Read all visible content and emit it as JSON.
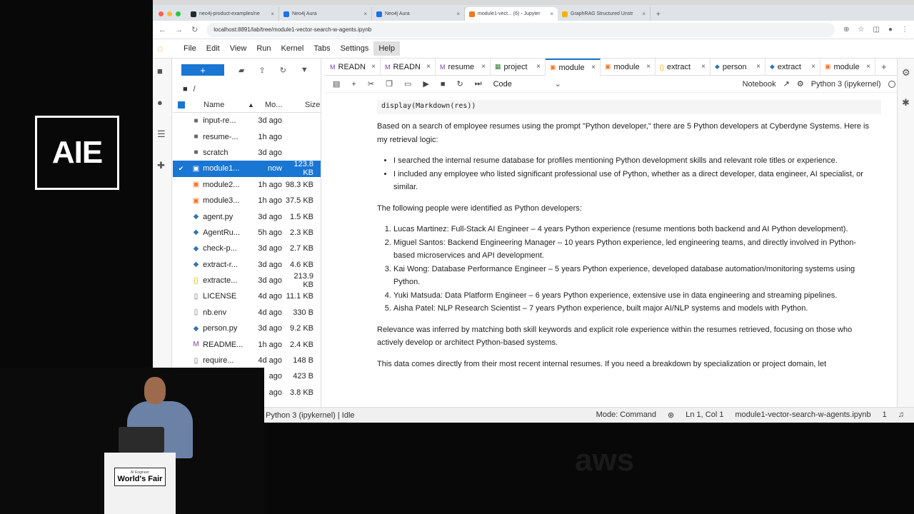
{
  "logo": {
    "text": "AIE"
  },
  "browser": {
    "tabs": [
      {
        "label": "neo4j-product-examples/ne",
        "color": "#24292f"
      },
      {
        "label": "Neo4j Aura",
        "color": "#1a73e8"
      },
      {
        "label": "Neo4j Aura",
        "color": "#1a73e8"
      },
      {
        "label": "module1-vect... (6) - Jupyter",
        "color": "#f37726"
      },
      {
        "label": "GraphRAG Structured Unstr",
        "color": "#f2b600"
      }
    ],
    "url": "localhost:8891/lab/tree/module1-vector-search-w-agents.ipynb"
  },
  "menu": [
    "File",
    "Edit",
    "View",
    "Run",
    "Kernel",
    "Tabs",
    "Settings",
    "Help"
  ],
  "filebrowser": {
    "new_label": "+",
    "breadcrumb": "/",
    "headers": {
      "name": "Name",
      "modified": "Mo...",
      "size": "Size"
    },
    "files": [
      {
        "icon": "folder-icon",
        "glyph": "■",
        "name": "input-re...",
        "modified": "3d ago",
        "size": ""
      },
      {
        "icon": "folder-icon",
        "glyph": "■",
        "name": "resume-...",
        "modified": "1h ago",
        "size": ""
      },
      {
        "icon": "folder-icon",
        "glyph": "■",
        "name": "scratch",
        "modified": "3d ago",
        "size": ""
      },
      {
        "icon": "notebook-icon",
        "glyph": "▣",
        "name": "module1...",
        "modified": "now",
        "size": "123.8 KB",
        "selected": true
      },
      {
        "icon": "notebook-icon",
        "glyph": "▣",
        "name": "module2...",
        "modified": "1h ago",
        "size": "98.3 KB"
      },
      {
        "icon": "notebook-icon",
        "glyph": "▣",
        "name": "module3...",
        "modified": "1h ago",
        "size": "37.5 KB"
      },
      {
        "icon": "python-icon",
        "glyph": "◆",
        "name": "agent.py",
        "modified": "3d ago",
        "size": "1.5 KB"
      },
      {
        "icon": "python-icon",
        "glyph": "◆",
        "name": "AgentRu...",
        "modified": "5h ago",
        "size": "2.3 KB"
      },
      {
        "icon": "python-icon",
        "glyph": "◆",
        "name": "check-p...",
        "modified": "3d ago",
        "size": "2.7 KB"
      },
      {
        "icon": "python-icon",
        "glyph": "◆",
        "name": "extract-r...",
        "modified": "3d ago",
        "size": "4.6 KB"
      },
      {
        "icon": "json-icon",
        "glyph": "{}",
        "name": "extracte...",
        "modified": "3d ago",
        "size": "213.9 KB"
      },
      {
        "icon": "file-icon",
        "glyph": "▯",
        "name": "LICENSE",
        "modified": "4d ago",
        "size": "11.1 KB"
      },
      {
        "icon": "file-icon",
        "glyph": "▯",
        "name": "nb.env",
        "modified": "4d ago",
        "size": "330 B"
      },
      {
        "icon": "python-icon",
        "glyph": "◆",
        "name": "person.py",
        "modified": "3d ago",
        "size": "9.2 KB"
      },
      {
        "icon": "markdown-icon",
        "glyph": "M",
        "name": "README...",
        "modified": "1h ago",
        "size": "2.4 KB"
      },
      {
        "icon": "file-icon",
        "glyph": "▯",
        "name": "require...",
        "modified": "4d ago",
        "size": "148 B"
      },
      {
        "icon": "file-icon",
        "glyph": "▯",
        "name": "",
        "modified": "ago",
        "size": "423 B"
      },
      {
        "icon": "file-icon",
        "glyph": "▯",
        "name": "",
        "modified": "ago",
        "size": "3.8 KB"
      }
    ]
  },
  "doc_tabs": [
    {
      "label": "READN",
      "icon": "markdown-icon",
      "glyph": "M"
    },
    {
      "label": "READN",
      "icon": "markdown-icon",
      "glyph": "M"
    },
    {
      "label": "resume",
      "icon": "markdown-icon",
      "glyph": "M"
    },
    {
      "label": "project",
      "icon": "table-icon",
      "glyph": "▦"
    },
    {
      "label": "module",
      "icon": "notebook-icon",
      "glyph": "▣",
      "active": true
    },
    {
      "label": "module",
      "icon": "notebook-icon",
      "glyph": "▣"
    },
    {
      "label": "extract",
      "icon": "json-icon",
      "glyph": "{}"
    },
    {
      "label": "person",
      "icon": "python-icon",
      "glyph": "◆"
    },
    {
      "label": "extract",
      "icon": "python-icon",
      "glyph": "◆"
    },
    {
      "label": "module",
      "icon": "notebook-icon",
      "glyph": "▣"
    }
  ],
  "nb_toolbar": {
    "cell_type": "Code",
    "notebook_label": "Notebook",
    "kernel": "Python 3 (ipykernel)"
  },
  "cell": {
    "code": "display(Markdown(res))",
    "intro": "Based on a search of employee resumes using the prompt \"Python developer,\" there are 5 Python developers at Cyberdyne Systems. Here is my retrieval logic:",
    "logic": [
      "I searched the internal resume database for profiles mentioning Python development skills and relevant role titles or experience.",
      "I included any employee who listed significant professional use of Python, whether as a direct developer, data engineer, AI specialist, or similar."
    ],
    "identified": "The following people were identified as Python developers:",
    "people": [
      "Lucas Martinez: Full-Stack AI Engineer – 4 years Python experience (resume mentions both backend and AI Python development).",
      "Miguel Santos: Backend Engineering Manager – 10 years Python experience, led engineering teams, and directly involved in Python-based microservices and API development.",
      "Kai Wong: Database Performance Engineer – 5 years Python experience, developed database automation/monitoring systems using Python.",
      "Yuki Matsuda: Data Platform Engineer – 6 years Python experience, extensive use in data engineering and streaming pipelines.",
      "Aisha Patel: NLP Research Scientist – 7 years Python experience, built major AI/NLP systems and models with Python."
    ],
    "relevance": "Relevance was inferred by matching both skill keywords and explicit role experience within the resumes retrieved, focusing on those who actively develop or architect Python-based systems.",
    "trailing": "This data comes directly from their most recent internal resumes. If you need a breakdown by specialization or project domain, let"
  },
  "statusbar": {
    "kernel": "Python 3 (ipykernel) | Idle",
    "mode": "Mode: Command",
    "position": "Ln 1, Col 1",
    "filename": "module1-vector-search-w-agents.ipynb",
    "count": "1"
  },
  "podium": {
    "small": "AI Engineer",
    "big": "World's Fair"
  },
  "watermark": "aws"
}
